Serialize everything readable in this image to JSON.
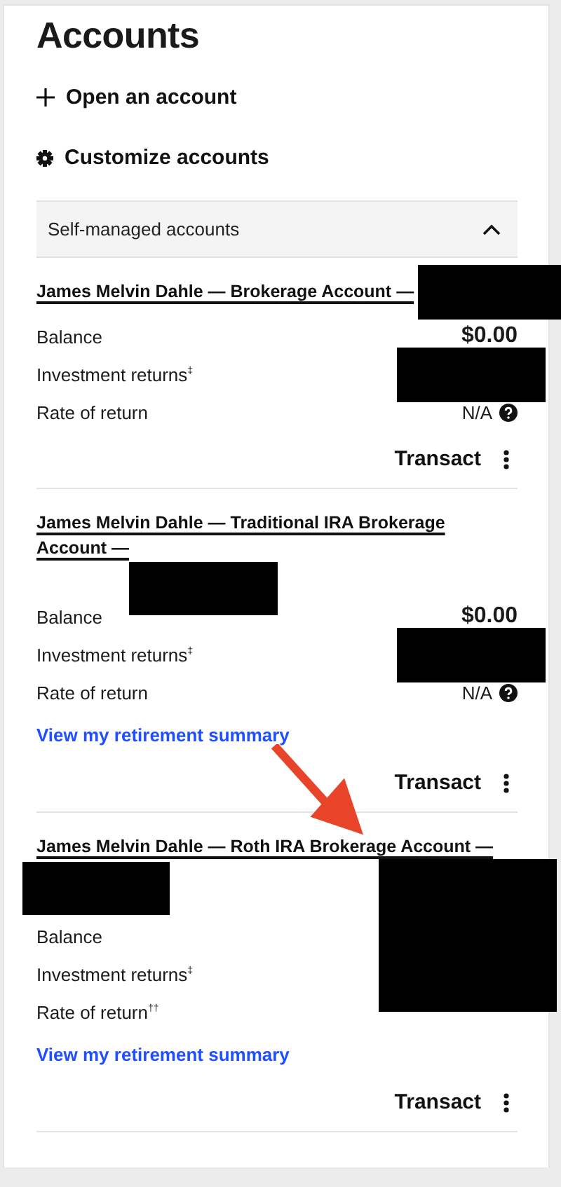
{
  "title": "Accounts",
  "actions": [
    {
      "kind": "add",
      "label": "Open an account"
    },
    {
      "kind": "settings",
      "label": "Customize accounts"
    }
  ],
  "section": {
    "label": "Self-managed accounts",
    "expanded": true
  },
  "accounts": [
    {
      "title": "James Melvin Dahle — Brokerage Account —",
      "title_redacted": true,
      "rows": [
        {
          "kind": "amount",
          "label": "Balance",
          "value": "$0.00"
        },
        {
          "kind": "redacted",
          "label": "Investment returns$^{‡}$"
        },
        {
          "kind": "rate",
          "label": "Rate of return",
          "value": "N/A"
        }
      ],
      "transact": "Transact"
    },
    {
      "title": "James Melvin Dahle — Traditional IRA Brokerage Account —",
      "title_redacted": true,
      "rows": [
        {
          "kind": "amount",
          "label": "Balance",
          "value": "$0.00"
        },
        {
          "kind": "redacted",
          "label": "Investment returns$^{‡}$"
        },
        {
          "kind": "rate",
          "label": "Rate of return",
          "value": "N/A"
        }
      ],
      "link": "View my retirement summary",
      "transact": "Transact"
    },
    {
      "title": "James Melvin Dahle — Roth IRA Brokerage Account —",
      "title_redacted": true,
      "values_redacted": true,
      "rows": [
        {
          "kind": "plain",
          "label": "Balance"
        },
        {
          "kind": "plain",
          "label": "Investment returns$^{‡}$"
        },
        {
          "kind": "plain",
          "label": "Rate of return$^{††}$"
        }
      ],
      "link": "View my retirement summary",
      "transact": "Transact"
    }
  ]
}
